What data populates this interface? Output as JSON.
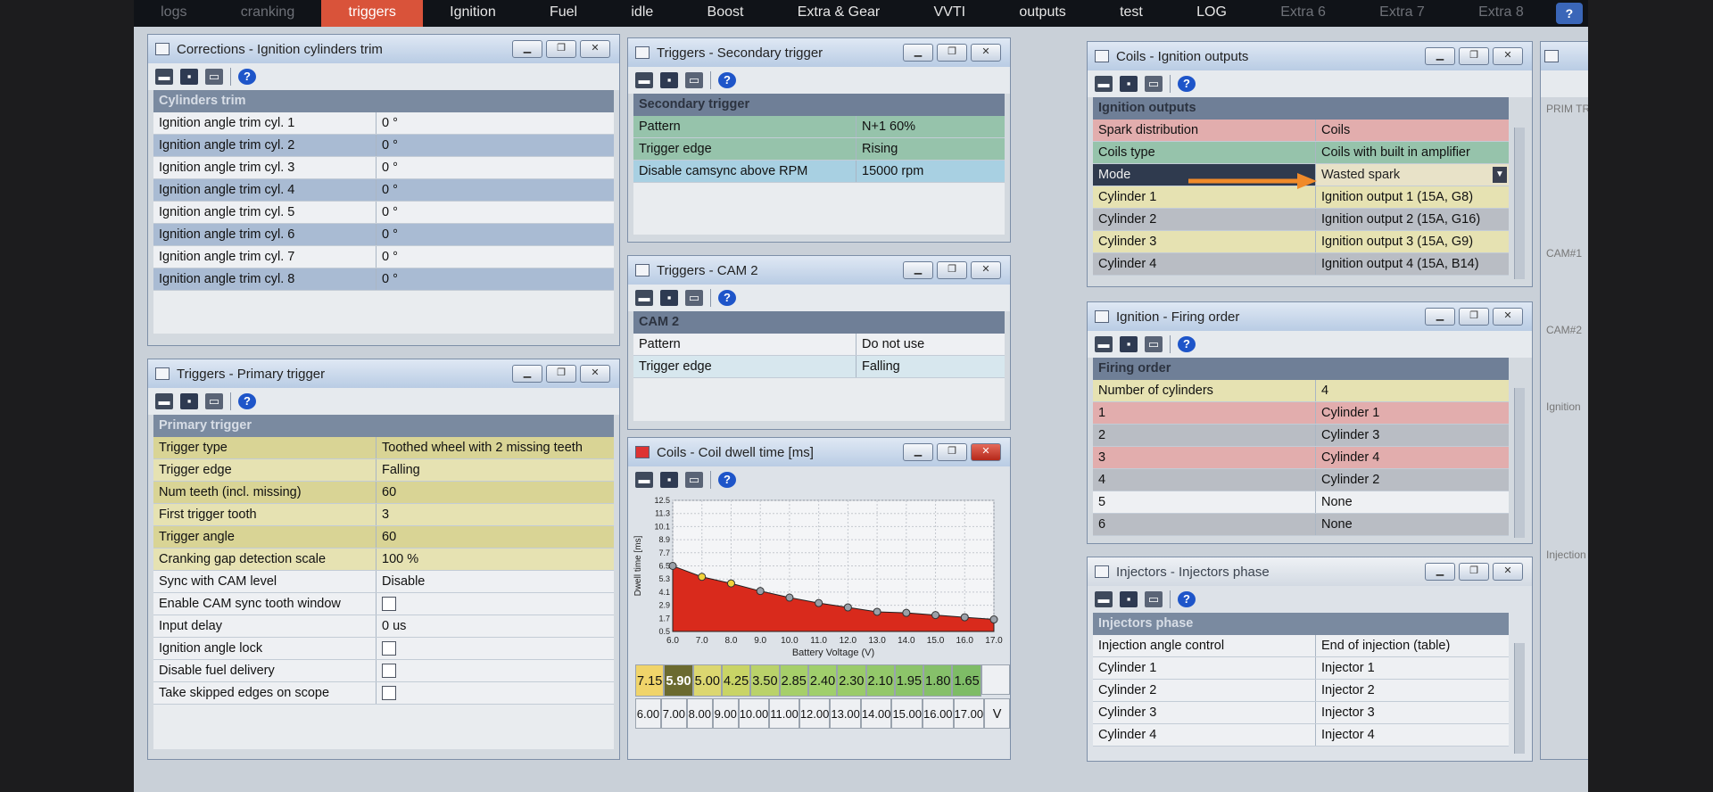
{
  "menu": {
    "tabs": [
      "logs",
      "cranking",
      "triggers",
      "Ignition",
      "Fuel",
      "idle",
      "Boost",
      "Extra & Gear",
      "VVTI",
      "outputs",
      "test",
      "LOG",
      "Extra 6",
      "Extra 7",
      "Extra 8"
    ],
    "active": "triggers",
    "help": "?"
  },
  "corrections": {
    "title": "Corrections - Ignition cylinders trim",
    "header": "Cylinders trim",
    "rows": [
      {
        "k": "Ignition angle trim cyl. 1",
        "v": "0 °"
      },
      {
        "k": "Ignition angle trim cyl. 2",
        "v": "0 °"
      },
      {
        "k": "Ignition angle trim cyl. 3",
        "v": "0 °"
      },
      {
        "k": "Ignition angle trim cyl. 4",
        "v": "0 °"
      },
      {
        "k": "Ignition angle trim cyl. 5",
        "v": "0 °"
      },
      {
        "k": "Ignition angle trim cyl. 6",
        "v": "0 °"
      },
      {
        "k": "Ignition angle trim cyl. 7",
        "v": "0 °"
      },
      {
        "k": "Ignition angle trim cyl. 8",
        "v": "0 °"
      }
    ]
  },
  "primary": {
    "title": "Triggers - Primary trigger",
    "header": "Primary trigger",
    "rows": [
      {
        "k": "Trigger type",
        "v": "Toothed wheel with 2 missing teeth"
      },
      {
        "k": "Trigger edge",
        "v": "Falling"
      },
      {
        "k": "Num teeth (incl. missing)",
        "v": "60"
      },
      {
        "k": "First trigger tooth",
        "v": "3"
      },
      {
        "k": "Trigger angle",
        "v": "60"
      },
      {
        "k": "Cranking gap detection scale",
        "v": "100 %"
      },
      {
        "k": "Sync with CAM level",
        "v": "Disable"
      },
      {
        "k": "Enable CAM sync tooth window",
        "v": ""
      },
      {
        "k": "Input delay",
        "v": "0 us"
      },
      {
        "k": "Ignition angle lock",
        "v": ""
      },
      {
        "k": "Disable fuel delivery",
        "v": ""
      },
      {
        "k": "Take skipped edges on scope",
        "v": ""
      }
    ]
  },
  "secondary": {
    "title": "Triggers - Secondary trigger",
    "header": "Secondary trigger",
    "rows": [
      {
        "k": "Pattern",
        "v": "N+1 60%"
      },
      {
        "k": "Trigger edge",
        "v": "Rising"
      },
      {
        "k": "Disable camsync above RPM",
        "v": "15000 rpm"
      }
    ]
  },
  "cam2": {
    "title": "Triggers - CAM 2",
    "header": "CAM 2",
    "rows": [
      {
        "k": "Pattern",
        "v": "Do not use"
      },
      {
        "k": "Trigger edge",
        "v": "Falling"
      }
    ]
  },
  "dwell": {
    "title": "Coils - Coil dwell time [ms]",
    "cells_top": [
      "7.15",
      "5.90",
      "5.00",
      "4.25",
      "3.50",
      "2.85",
      "2.40",
      "2.30",
      "2.10",
      "1.95",
      "1.80",
      "1.65"
    ],
    "cells_bottom": [
      "6.00",
      "7.00",
      "8.00",
      "9.00",
      "10.00",
      "11.00",
      "12.00",
      "13.00",
      "14.00",
      "15.00",
      "16.00",
      "17.00"
    ],
    "unit": "V"
  },
  "chart_data": {
    "type": "area",
    "x": [
      6,
      7,
      8,
      9,
      10,
      11,
      12,
      13,
      14,
      15,
      16,
      17
    ],
    "values": [
      6.5,
      5.5,
      4.9,
      4.2,
      3.6,
      3.1,
      2.7,
      2.3,
      2.2,
      2.0,
      1.8,
      1.6
    ],
    "xlabel": "Battery Voltage (V)",
    "ylabel": "Dwell time [ms]",
    "xlim": [
      6,
      17
    ],
    "ylim": [
      0.5,
      12.5
    ],
    "xticks": [
      "6.0",
      "7.0",
      "8.0",
      "9.0",
      "10.0",
      "11.0",
      "12.0",
      "13.0",
      "14.0",
      "15.0",
      "16.0",
      "17.0"
    ],
    "yticks": [
      "12.5",
      "11.3",
      "10.1",
      "8.9",
      "7.7",
      "6.5",
      "5.3",
      "4.1",
      "2.9",
      "1.7",
      "0.5"
    ],
    "ytick_values": [
      12.5,
      11.3,
      10.1,
      8.9,
      7.7,
      6.5,
      5.3,
      4.1,
      2.9,
      1.7,
      0.5
    ],
    "fill_color": "#d92a1c",
    "grid": true
  },
  "ignition_outputs": {
    "title": "Coils - Ignition outputs",
    "header": "Ignition outputs",
    "rows": [
      {
        "k": "Spark distribution",
        "v": "Coils"
      },
      {
        "k": "Coils type",
        "v": "Coils with built in amplifier"
      },
      {
        "k": "Mode",
        "v": "Wasted spark"
      },
      {
        "k": "Cylinder 1",
        "v": "Ignition output 1 (15A, G8)"
      },
      {
        "k": "Cylinder 2",
        "v": "Ignition output 2 (15A, G16)"
      },
      {
        "k": "Cylinder 3",
        "v": "Ignition output 3 (15A, G9)"
      },
      {
        "k": "Cylinder 4",
        "v": "Ignition output 4 (15A, B14)"
      }
    ]
  },
  "firing": {
    "title": "Ignition - Firing order",
    "header": "Firing order",
    "rows": [
      {
        "k": "Number of cylinders",
        "v": "4"
      },
      {
        "k": "1",
        "v": "Cylinder 1"
      },
      {
        "k": "2",
        "v": "Cylinder 3"
      },
      {
        "k": "3",
        "v": "Cylinder 4"
      },
      {
        "k": "4",
        "v": "Cylinder 2"
      },
      {
        "k": "5",
        "v": "None"
      },
      {
        "k": "6",
        "v": "None"
      }
    ]
  },
  "injectors": {
    "title": "Injectors - Injectors phase",
    "header": "Injectors phase",
    "rows": [
      {
        "k": "Injection angle control",
        "v": "End of injection (table)"
      },
      {
        "k": "Cylinder 1",
        "v": "Injector 1"
      },
      {
        "k": "Cylinder 2",
        "v": "Injector 2"
      },
      {
        "k": "Cylinder 3",
        "v": "Injector 3"
      },
      {
        "k": "Cylinder 4",
        "v": "Injector 4"
      }
    ]
  },
  "side_panel": {
    "labels": [
      "PRIM TR",
      "CAM#1",
      "CAM#2",
      "Ignition",
      "Injection"
    ]
  },
  "icons": {
    "minimize": "minimize-icon",
    "maximize": "maximize-icon",
    "close": "close-icon"
  }
}
